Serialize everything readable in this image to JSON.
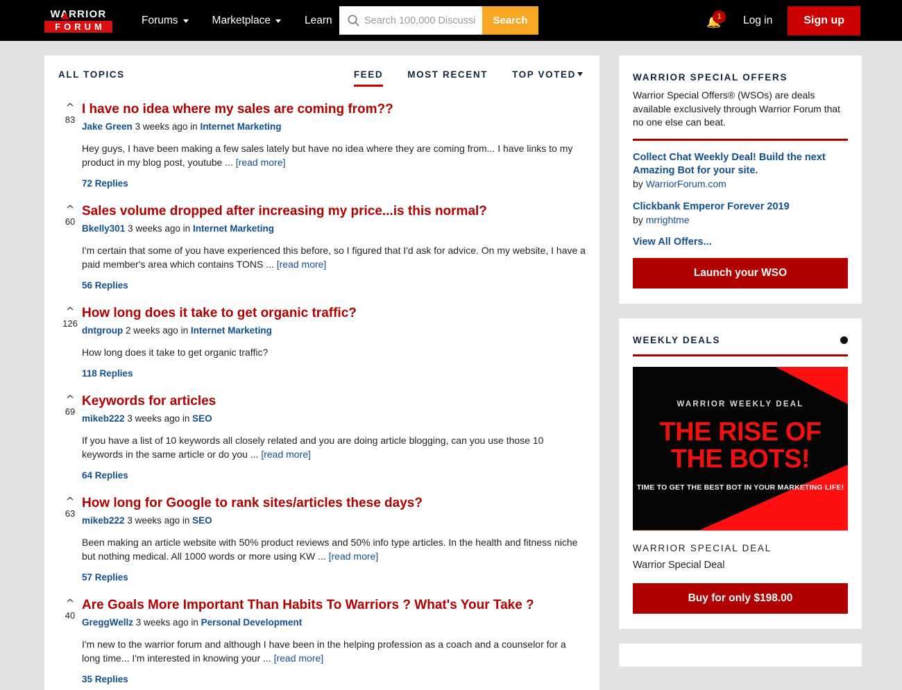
{
  "header": {
    "logo_top": "WARRIOR",
    "logo_bottom": "FORUM",
    "nav": [
      {
        "label": "Forums",
        "has_caret": true
      },
      {
        "label": "Marketplace",
        "has_caret": true
      },
      {
        "label": "Learn",
        "has_caret": false
      }
    ],
    "search": {
      "placeholder": "Search 100,000 Discussi",
      "button_label": "Search",
      "icon": "search-icon"
    },
    "notifications": {
      "icon": "bell-icon",
      "badge_count": "1"
    },
    "login_label": "Log in",
    "signup_label": "Sign up",
    "colors": {
      "bar": "#000000",
      "search_button": "#f6a623",
      "signup": "#cc0000",
      "badge": "#b80000"
    }
  },
  "main": {
    "section_label": "ALL TOPICS",
    "tabs": [
      {
        "label": "FEED",
        "active": true,
        "caret": false
      },
      {
        "label": "MOST RECENT",
        "active": false,
        "caret": false
      },
      {
        "label": "TOP VOTED",
        "active": false,
        "caret": true
      }
    ],
    "topics": [
      {
        "votes": "83",
        "title": "I have no idea where my sales are coming from??",
        "user": "Jake Green",
        "time": "3 weeks ago",
        "in_word": "in",
        "category": "Internet Marketing",
        "excerpt": "Hey guys, I have been making a few sales lately but have no idea where they are coming from... I have links to my product in my blog post, youtube ...",
        "read_more": "[read more]",
        "replies": "72 Replies"
      },
      {
        "votes": "60",
        "title": "Sales volume dropped after increasing my price...is this normal?",
        "user": "Bkelly301",
        "time": "3 weeks ago",
        "in_word": "in",
        "category": "Internet Marketing",
        "excerpt": "I'm certain that some of you have experienced this before, so I figured that I'd ask for advice. On my website, I have a paid member's area which contains TONS ...",
        "read_more": "[read more]",
        "replies": "56 Replies"
      },
      {
        "votes": "126",
        "title": "How long does it take to get organic traffic?",
        "user": "dntgroup",
        "time": "2 weeks ago",
        "in_word": "in",
        "category": "Internet Marketing",
        "excerpt": "How long does it take to get organic traffic?",
        "read_more": "",
        "replies": "118 Replies"
      },
      {
        "votes": "69",
        "title": "Keywords for articles",
        "user": "mikeb222",
        "time": "3 weeks ago",
        "in_word": "in",
        "category": "SEO",
        "excerpt": "If you have a list of 10 keywords all closely related and you are doing article blogging, can you use those 10 keywords in the same article or do you ...",
        "read_more": "[read more]",
        "replies": "64 Replies"
      },
      {
        "votes": "63",
        "title": "How long for Google to rank sites/articles these days?",
        "user": "mikeb222",
        "time": "3 weeks ago",
        "in_word": "in",
        "category": "SEO",
        "excerpt": "Been making an article website with 50% product reviews and 50% info type articles. In the health and fitness niche but nothing medical. All 1000 words or more using KW ...",
        "read_more": "[read more]",
        "replies": "57 Replies"
      },
      {
        "votes": "40",
        "title": "Are Goals More Important Than Habits To Warriors ? What's Your Take ?",
        "user": "GreggWellz",
        "time": "3 weeks ago",
        "in_word": "in",
        "category": "Personal Development",
        "excerpt": "I'm new to the warrior forum and although I have been in the helping profession as a coach and a counselor for a long time... I'm interested in knowing your ...",
        "read_more": "[read more]",
        "replies": "35 Replies"
      }
    ]
  },
  "sidebar": {
    "wso": {
      "title": "WARRIOR SPECIAL OFFERS",
      "description": "Warrior Special Offers® (WSOs) are deals available exclusively through Warrior Forum that no one else can beat.",
      "offers": [
        {
          "title": "Collect Chat Weekly Deal! Build the next Amazing Bot for your site.",
          "by_prefix": "by",
          "author": "WarriorForum.com"
        },
        {
          "title": "Clickbank Emperor Forever 2019",
          "by_prefix": "by",
          "author": "mrrightme"
        }
      ],
      "view_all": "View All Offers...",
      "cta": "Launch your WSO"
    },
    "weekly_deals": {
      "title": "WEEKLY DEALS",
      "indicator": "carousel-dot",
      "banner": {
        "kicker": "WARRIOR WEEKLY DEAL",
        "headline_line1": "THE RISE OF",
        "headline_line2": "THE BOTS!",
        "subline": "TIME TO GET THE BEST BOT IN YOUR MARKETING LIFE!"
      },
      "label": "WARRIOR SPECIAL DEAL",
      "name": "Warrior Special Deal",
      "cta": "Buy for only $198.00"
    }
  }
}
